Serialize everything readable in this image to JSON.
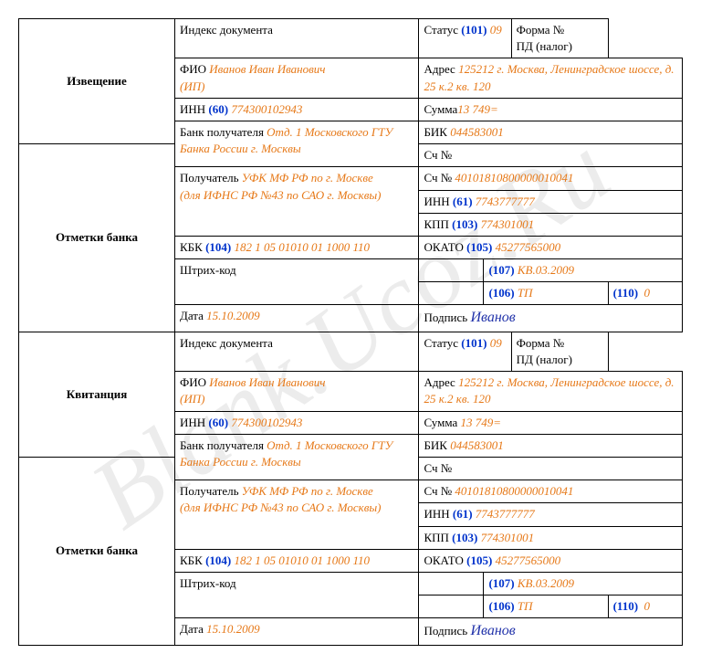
{
  "watermark": "Blank.Ucoz.Ru",
  "labels": {
    "izv": "Извещение",
    "kvit": "Квитанция",
    "otm": "Отметки банка",
    "index": "Индекс документа",
    "status": "Статус",
    "form": "Форма №\nПД (налог)",
    "fio": "ФИО",
    "adr": "Адрес",
    "inn60": "ИНН",
    "sum": "Сумма",
    "bank": "Банк получателя",
    "bik": "БИК",
    "sch": "Сч №",
    "schno": "Сч №",
    "recv": "Получатель",
    "inn61": "ИНН",
    "kpp": "КПП",
    "kbk": "КБК",
    "okato": "ОКАТО",
    "shtrih": "Штрих-код",
    "data": "Дата",
    "podpis": "Подпись"
  },
  "codes": {
    "c101": "(101)",
    "c60": "(60)",
    "c61": "(61)",
    "c103": "(103)",
    "c104": "(104)",
    "c105": "(105)",
    "c106": "(106)",
    "c107": "(107)",
    "c110": "(110)"
  },
  "v": {
    "status": "09",
    "fio": "Иванов Иван Иванович",
    "ip": "(ИП)",
    "adr": "125212 г. Москва, Ленинградское шоссе, д. 25 к.2 кв. 120",
    "inn60": "774300102943",
    "sum": "13 749=",
    "bank": "Отд. 1 Московского ГТУ Банка России г. Москвы",
    "bik": "044583001",
    "recv": "УФК МФ РФ по г. Москве",
    "recv2": "(для ИФНС РФ №43 по САО г. Москвы)",
    "sch": "40101810800000010041",
    "inn61": "7743777777",
    "kpp": "774301001",
    "kbk": "182 1 05 01010 01 1000 110",
    "okato": "45277565000",
    "c107": "КВ.03.2009",
    "c106": "ТП",
    "c110": "0",
    "data": "15.10.2009",
    "sig": "Иванов"
  }
}
